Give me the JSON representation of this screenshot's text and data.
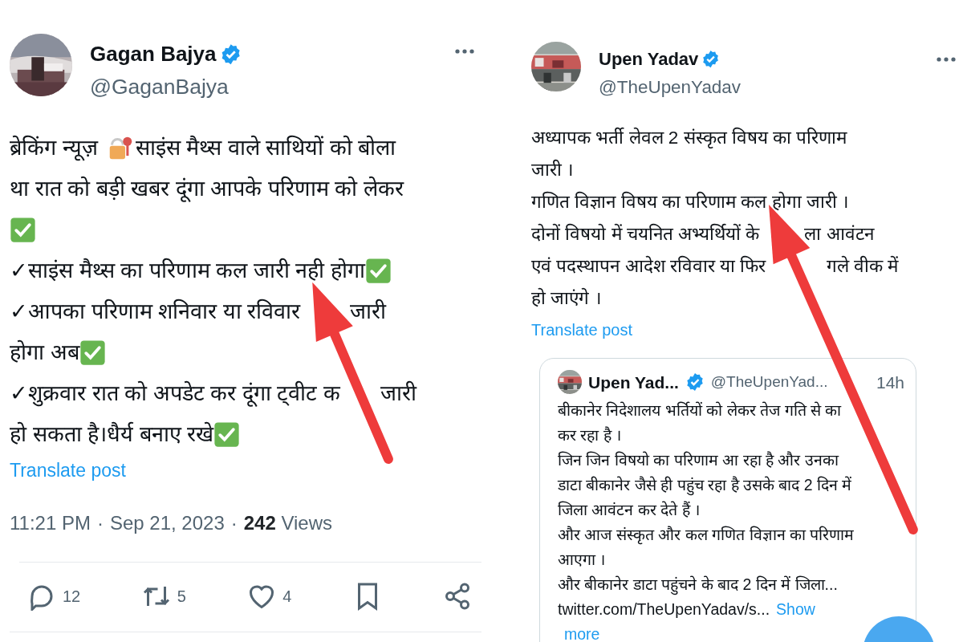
{
  "left_post": {
    "author": {
      "name": "Gagan Bajya",
      "handle": "@GaganBajya",
      "verified": true
    },
    "body": [
      [
        {
          "kind": "text",
          "text": "ब्रेकिंग न्यूज़"
        },
        {
          "kind": "lock"
        },
        {
          "kind": "text",
          "text": "साइंस मैथ्स वाले साथियों को बोला"
        }
      ],
      [
        {
          "kind": "text",
          "text": "था रात को बड़ी खबर दूंगा आपके परिणाम  को लेकर"
        }
      ],
      [
        {
          "kind": "check"
        }
      ],
      [
        {
          "kind": "text",
          "text": "✓साइंस मैथ्स का परिणाम कल जारी नही होगा"
        },
        {
          "kind": "check"
        }
      ],
      [
        {
          "kind": "text",
          "text": "✓आपका परिणाम शनिवार या रविवार"
        },
        {
          "kind": "gap"
        },
        {
          "kind": "text",
          "text": "जारी"
        }
      ],
      [
        {
          "kind": "text",
          "text": "होगा अब"
        },
        {
          "kind": "check"
        }
      ],
      [
        {
          "kind": "text",
          "text": "✓शुक्रवार रात को अपडेट कर दूंगा ट्वीट क"
        },
        {
          "kind": "gap"
        },
        {
          "kind": "text",
          "text": "जारी"
        }
      ],
      [
        {
          "kind": "text",
          "text": "हो सकता है।धैर्य बनाए रखे"
        },
        {
          "kind": "check"
        }
      ]
    ],
    "translate": "Translate post",
    "meta": {
      "time": "11:21 PM",
      "separator": "·",
      "date": "Sep 21, 2023",
      "views": "242",
      "views_label": "Views"
    },
    "actions": [
      {
        "kind": "reply",
        "count": "12"
      },
      {
        "kind": "repost",
        "count": "5"
      },
      {
        "kind": "like",
        "count": "4"
      },
      {
        "kind": "bookmark"
      },
      {
        "kind": "share"
      }
    ]
  },
  "right_post": {
    "author": {
      "name": "Upen Yadav",
      "handle": "@TheUpenYadav",
      "verified": true
    },
    "body": [
      [
        {
          "kind": "text",
          "text": "अध्यापक भर्ती लेवल 2 संस्कृत विषय का परिणाम"
        }
      ],
      [
        {
          "kind": "text",
          "text": "जारी ।"
        }
      ],
      [
        {
          "kind": "text",
          "text": "गणित विज्ञान विषय का परिणाम कल होगा जारी ।"
        }
      ],
      [
        {
          "kind": "text",
          "text": "दोनों विषयो में चयनित अभ्यर्थियों के"
        },
        {
          "kind": "gap"
        },
        {
          "kind": "text",
          "text": "ला आवंटन"
        }
      ],
      [
        {
          "kind": "text",
          "text": "एवं पदस्थापन आदेश रविवार या फिर"
        },
        {
          "kind": "gap"
        },
        {
          "kind": "text",
          "text": "गले वीक में"
        }
      ],
      [
        {
          "kind": "text",
          "text": "हो जाएंगे ।"
        }
      ]
    ],
    "translate": "Translate post",
    "quote": {
      "author": {
        "name": "Upen Yad...",
        "handle": "@TheUpenYad...",
        "verified": true
      },
      "time": "14h",
      "body": [
        [
          {
            "kind": "text",
            "text": "बीकानेर निदेशालय भर्तियों को लेकर तेज गति से का"
          }
        ],
        [
          {
            "kind": "text",
            "text": "कर रहा है ।"
          }
        ],
        [
          {
            "kind": "text",
            "text": "जिन जिन विषयो का परिणाम आ रहा है और उनका"
          }
        ],
        [
          {
            "kind": "text",
            "text": "डाटा बीकानेर जैसे ही पहुंच रहा है उसके बाद 2 दिन में"
          }
        ],
        [
          {
            "kind": "text",
            "text": "जिला आवंटन कर देते हैं ।"
          }
        ],
        [
          {
            "kind": "text",
            "text": "और आज संस्कृत और कल गणित विज्ञान का परिणाम"
          }
        ],
        [
          {
            "kind": "text",
            "text": "आएगा ।"
          }
        ],
        [
          {
            "kind": "text",
            "text": "और बीकानेर डाटा पहुंचने के बाद 2 दिन में जिला..."
          }
        ],
        [
          {
            "kind": "link",
            "text": "twitter.com/TheUpenYadav/s..."
          },
          {
            "kind": "more",
            "text": "Show"
          }
        ],
        [
          {
            "kind": "more",
            "text": "more"
          }
        ]
      ]
    }
  }
}
